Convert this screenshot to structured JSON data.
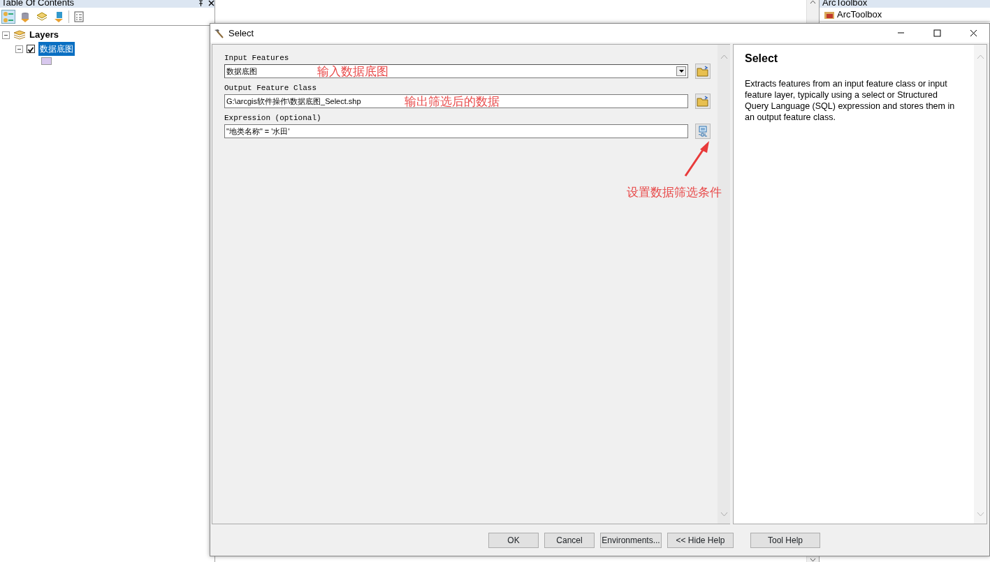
{
  "toc": {
    "title": "Table Of Contents",
    "layers": {
      "label": "Layers",
      "expanded": true,
      "children": [
        {
          "label": "数据底图",
          "checked": true,
          "selected": true,
          "expanded": true
        }
      ]
    }
  },
  "toolbox": {
    "title": "ArcToolbox",
    "items": [
      {
        "label": "ArcToolbox"
      }
    ]
  },
  "dialog": {
    "title": "Select",
    "params": [
      {
        "label": "Input Features",
        "value": "数据底图",
        "kind": "dropdown",
        "button": {
          "kind": "browse"
        },
        "note": "输入数据底图"
      },
      {
        "label": "Output Feature Class",
        "value": "G:\\arcgis软件操作\\数据底图_Select.shp",
        "kind": "text",
        "button": {
          "kind": "browse"
        },
        "note": "输出筛选后的数据"
      },
      {
        "label": "Expression (optional)",
        "value": "\"地类名称\" = '水田'",
        "kind": "text",
        "button": {
          "kind": "sql"
        },
        "note": "设置数据筛选条件"
      }
    ],
    "help": {
      "title": "Select",
      "text": "Extracts features from an input feature class or input feature layer, typically using a select or Structured Query Language (SQL) expression and stores them in an output feature class."
    },
    "buttons": [
      "OK",
      "Cancel",
      "Environments...",
      "<< Hide Help",
      "Tool Help"
    ]
  }
}
